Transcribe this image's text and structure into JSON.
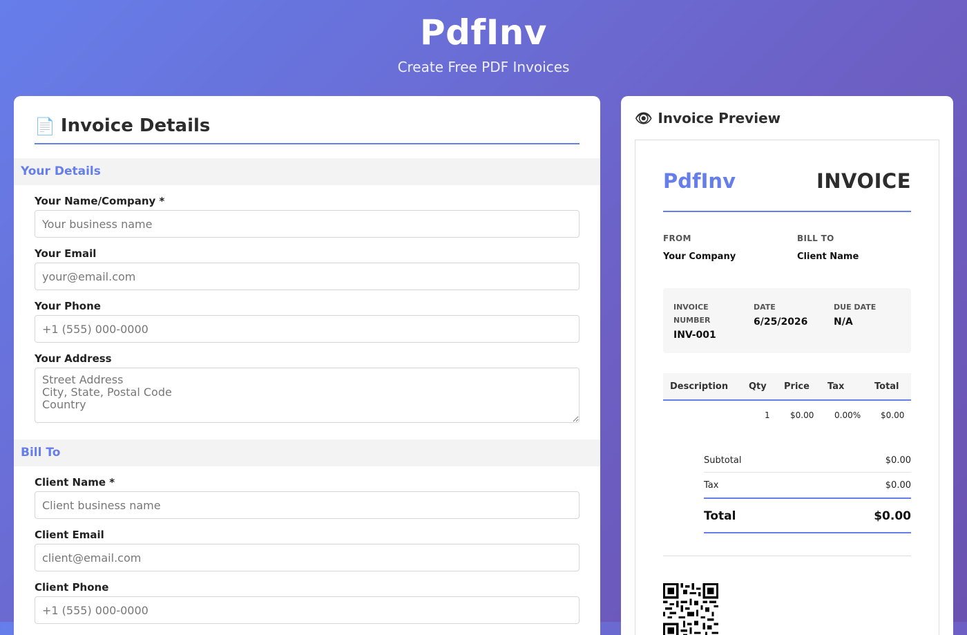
{
  "header": {
    "title": "PdfInv",
    "subtitle": "Create Free PDF Invoices"
  },
  "form": {
    "heading_icon": "📄",
    "heading": "Invoice Details",
    "your_details": {
      "section_title": "Your Details",
      "name_label": "Your Name/Company *",
      "name_placeholder": "Your business name",
      "email_label": "Your Email",
      "email_placeholder": "your@email.com",
      "phone_label": "Your Phone",
      "phone_placeholder": "+1 (555) 000-0000",
      "address_label": "Your Address",
      "address_placeholder": "Street Address\nCity, State, Postal Code\nCountry"
    },
    "bill_to": {
      "section_title": "Bill To",
      "client_name_label": "Client Name *",
      "client_name_placeholder": "Client business name",
      "client_email_label": "Client Email",
      "client_email_placeholder": "client@email.com",
      "client_phone_label": "Client Phone",
      "client_phone_placeholder": "+1 (555) 000-0000"
    }
  },
  "preview": {
    "heading_icon": "👁",
    "heading": "Invoice Preview",
    "brand": "PdfInv",
    "title": "INVOICE",
    "from_label": "FROM",
    "from_name": "Your Company",
    "to_label": "BILL TO",
    "to_name": "Client Name",
    "meta": {
      "number_label": "INVOICE NUMBER",
      "number_value": "INV-001",
      "date_label": "DATE",
      "date_value": "6/25/2026",
      "due_label": "DUE DATE",
      "due_value": "N/A"
    },
    "table": {
      "headers": [
        "Description",
        "Qty",
        "Price",
        "Tax",
        "Total"
      ],
      "rows": [
        {
          "description": "",
          "qty": "1",
          "price": "$0.00",
          "tax": "0.00%",
          "total": "$0.00"
        }
      ]
    },
    "totals": {
      "subtotal_label": "Subtotal",
      "subtotal_value": "$0.00",
      "tax_label": "Tax",
      "tax_value": "$0.00",
      "total_label": "Total",
      "total_value": "$0.00"
    }
  },
  "colors": {
    "accent": "#667eea",
    "bg_gradient_end": "#6a52b0"
  },
  "icons": {
    "qr": "qr-code-icon"
  }
}
